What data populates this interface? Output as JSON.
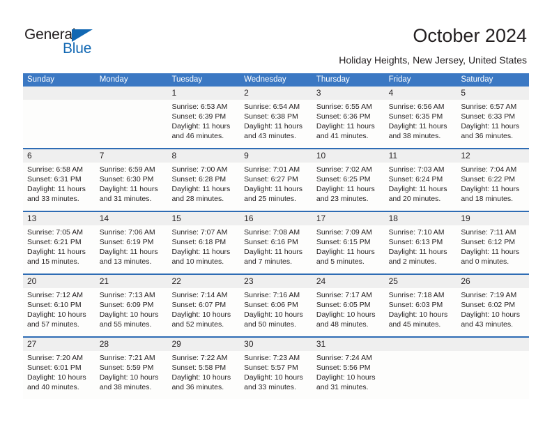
{
  "brand": {
    "name_top": "General",
    "name_bottom": "Blue",
    "triangle_icon": "triangle-icon",
    "color_dark": "#231f20",
    "color_blue": "#1268b3"
  },
  "header": {
    "title": "October 2024",
    "subtitle": "Holiday Heights, New Jersey, United States"
  },
  "theme": {
    "header_blue": "#3b78c3",
    "rule_blue": "#2e6cb4",
    "date_band_gray": "#efefef",
    "cell_bg": "#fdfdfc",
    "text": "#231f20"
  },
  "weekdays": [
    "Sunday",
    "Monday",
    "Tuesday",
    "Wednesday",
    "Thursday",
    "Friday",
    "Saturday"
  ],
  "weeks": [
    {
      "days": [
        {
          "num": "",
          "lines": []
        },
        {
          "num": "",
          "lines": []
        },
        {
          "num": "1",
          "lines": [
            "Sunrise: 6:53 AM",
            "Sunset: 6:39 PM",
            "Daylight: 11 hours",
            "and 46 minutes."
          ]
        },
        {
          "num": "2",
          "lines": [
            "Sunrise: 6:54 AM",
            "Sunset: 6:38 PM",
            "Daylight: 11 hours",
            "and 43 minutes."
          ]
        },
        {
          "num": "3",
          "lines": [
            "Sunrise: 6:55 AM",
            "Sunset: 6:36 PM",
            "Daylight: 11 hours",
            "and 41 minutes."
          ]
        },
        {
          "num": "4",
          "lines": [
            "Sunrise: 6:56 AM",
            "Sunset: 6:35 PM",
            "Daylight: 11 hours",
            "and 38 minutes."
          ]
        },
        {
          "num": "5",
          "lines": [
            "Sunrise: 6:57 AM",
            "Sunset: 6:33 PM",
            "Daylight: 11 hours",
            "and 36 minutes."
          ]
        }
      ]
    },
    {
      "days": [
        {
          "num": "6",
          "lines": [
            "Sunrise: 6:58 AM",
            "Sunset: 6:31 PM",
            "Daylight: 11 hours",
            "and 33 minutes."
          ]
        },
        {
          "num": "7",
          "lines": [
            "Sunrise: 6:59 AM",
            "Sunset: 6:30 PM",
            "Daylight: 11 hours",
            "and 31 minutes."
          ]
        },
        {
          "num": "8",
          "lines": [
            "Sunrise: 7:00 AM",
            "Sunset: 6:28 PM",
            "Daylight: 11 hours",
            "and 28 minutes."
          ]
        },
        {
          "num": "9",
          "lines": [
            "Sunrise: 7:01 AM",
            "Sunset: 6:27 PM",
            "Daylight: 11 hours",
            "and 25 minutes."
          ]
        },
        {
          "num": "10",
          "lines": [
            "Sunrise: 7:02 AM",
            "Sunset: 6:25 PM",
            "Daylight: 11 hours",
            "and 23 minutes."
          ]
        },
        {
          "num": "11",
          "lines": [
            "Sunrise: 7:03 AM",
            "Sunset: 6:24 PM",
            "Daylight: 11 hours",
            "and 20 minutes."
          ]
        },
        {
          "num": "12",
          "lines": [
            "Sunrise: 7:04 AM",
            "Sunset: 6:22 PM",
            "Daylight: 11 hours",
            "and 18 minutes."
          ]
        }
      ]
    },
    {
      "days": [
        {
          "num": "13",
          "lines": [
            "Sunrise: 7:05 AM",
            "Sunset: 6:21 PM",
            "Daylight: 11 hours",
            "and 15 minutes."
          ]
        },
        {
          "num": "14",
          "lines": [
            "Sunrise: 7:06 AM",
            "Sunset: 6:19 PM",
            "Daylight: 11 hours",
            "and 13 minutes."
          ]
        },
        {
          "num": "15",
          "lines": [
            "Sunrise: 7:07 AM",
            "Sunset: 6:18 PM",
            "Daylight: 11 hours",
            "and 10 minutes."
          ]
        },
        {
          "num": "16",
          "lines": [
            "Sunrise: 7:08 AM",
            "Sunset: 6:16 PM",
            "Daylight: 11 hours",
            "and 7 minutes."
          ]
        },
        {
          "num": "17",
          "lines": [
            "Sunrise: 7:09 AM",
            "Sunset: 6:15 PM",
            "Daylight: 11 hours",
            "and 5 minutes."
          ]
        },
        {
          "num": "18",
          "lines": [
            "Sunrise: 7:10 AM",
            "Sunset: 6:13 PM",
            "Daylight: 11 hours",
            "and 2 minutes."
          ]
        },
        {
          "num": "19",
          "lines": [
            "Sunrise: 7:11 AM",
            "Sunset: 6:12 PM",
            "Daylight: 11 hours",
            "and 0 minutes."
          ]
        }
      ]
    },
    {
      "days": [
        {
          "num": "20",
          "lines": [
            "Sunrise: 7:12 AM",
            "Sunset: 6:10 PM",
            "Daylight: 10 hours",
            "and 57 minutes."
          ]
        },
        {
          "num": "21",
          "lines": [
            "Sunrise: 7:13 AM",
            "Sunset: 6:09 PM",
            "Daylight: 10 hours",
            "and 55 minutes."
          ]
        },
        {
          "num": "22",
          "lines": [
            "Sunrise: 7:14 AM",
            "Sunset: 6:07 PM",
            "Daylight: 10 hours",
            "and 52 minutes."
          ]
        },
        {
          "num": "23",
          "lines": [
            "Sunrise: 7:16 AM",
            "Sunset: 6:06 PM",
            "Daylight: 10 hours",
            "and 50 minutes."
          ]
        },
        {
          "num": "24",
          "lines": [
            "Sunrise: 7:17 AM",
            "Sunset: 6:05 PM",
            "Daylight: 10 hours",
            "and 48 minutes."
          ]
        },
        {
          "num": "25",
          "lines": [
            "Sunrise: 7:18 AM",
            "Sunset: 6:03 PM",
            "Daylight: 10 hours",
            "and 45 minutes."
          ]
        },
        {
          "num": "26",
          "lines": [
            "Sunrise: 7:19 AM",
            "Sunset: 6:02 PM",
            "Daylight: 10 hours",
            "and 43 minutes."
          ]
        }
      ]
    },
    {
      "days": [
        {
          "num": "27",
          "lines": [
            "Sunrise: 7:20 AM",
            "Sunset: 6:01 PM",
            "Daylight: 10 hours",
            "and 40 minutes."
          ]
        },
        {
          "num": "28",
          "lines": [
            "Sunrise: 7:21 AM",
            "Sunset: 5:59 PM",
            "Daylight: 10 hours",
            "and 38 minutes."
          ]
        },
        {
          "num": "29",
          "lines": [
            "Sunrise: 7:22 AM",
            "Sunset: 5:58 PM",
            "Daylight: 10 hours",
            "and 36 minutes."
          ]
        },
        {
          "num": "30",
          "lines": [
            "Sunrise: 7:23 AM",
            "Sunset: 5:57 PM",
            "Daylight: 10 hours",
            "and 33 minutes."
          ]
        },
        {
          "num": "31",
          "lines": [
            "Sunrise: 7:24 AM",
            "Sunset: 5:56 PM",
            "Daylight: 10 hours",
            "and 31 minutes."
          ]
        },
        {
          "num": "",
          "lines": []
        },
        {
          "num": "",
          "lines": []
        }
      ]
    }
  ]
}
